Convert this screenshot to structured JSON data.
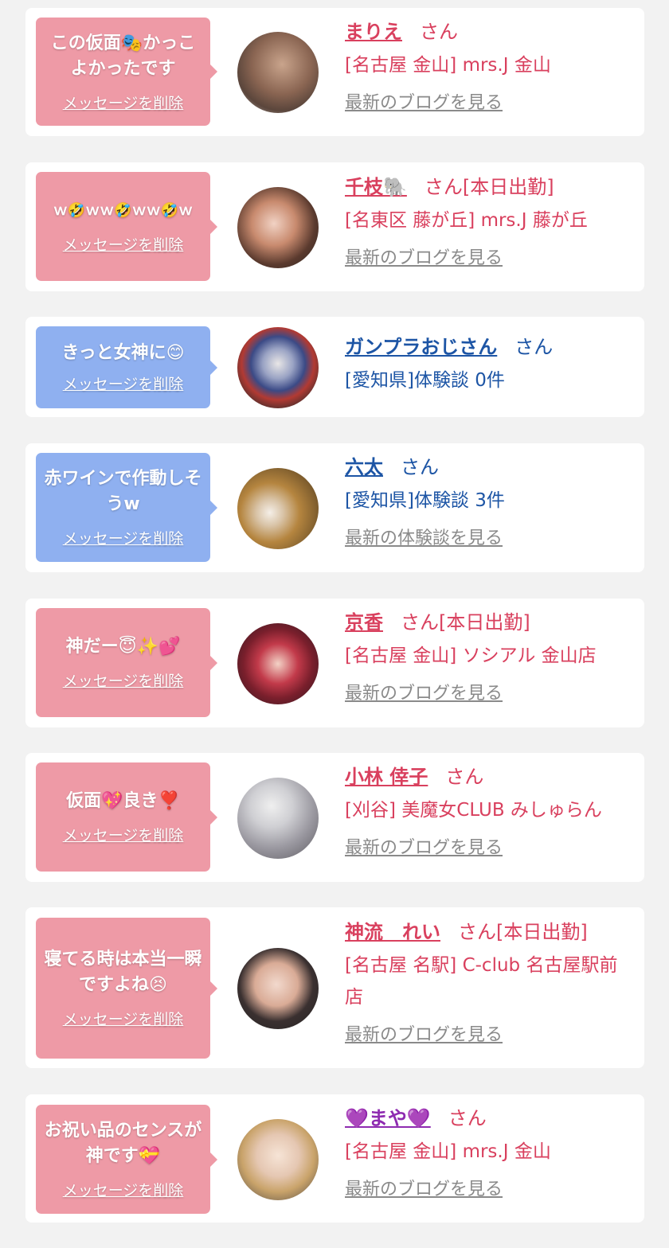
{
  "delete_label": "メッセージを削除",
  "cards": [
    {
      "message": "この仮面🎭かっこよかったです",
      "name": "まりえ",
      "suffix": "さん",
      "place": "[名古屋 金山] mrs.J 金山",
      "link": "最新のブログを見る",
      "theme": "pink"
    },
    {
      "message": "ｗ🤣ｗｗ🤣ｗｗ🤣ｗ",
      "name": "千枝🐘",
      "suffix": "さん[本日出勤]",
      "place": "[名東区 藤が丘] mrs.J 藤が丘",
      "link": "最新のブログを見る",
      "theme": "pink"
    },
    {
      "message": "きっと女神に😊",
      "name": "ガンプラおじさん",
      "suffix": "さん",
      "place": "[愛知県]体験談 0件",
      "link": "",
      "theme": "blue"
    },
    {
      "message": "赤ワインで作動しそうw",
      "name": "六太",
      "suffix": "さん",
      "place": "[愛知県]体験談 3件",
      "link": "最新の体験談を見る",
      "theme": "blue"
    },
    {
      "message": "神だー😇✨💕",
      "name": "京香",
      "suffix": "さん[本日出勤]",
      "place": "[名古屋 金山] ソシアル 金山店",
      "link": "最新のブログを見る",
      "theme": "pink"
    },
    {
      "message": "仮面💖良き❣️",
      "name": "小林 倖子",
      "suffix": "さん",
      "place": "[刈谷] 美魔女CLUB みしゅらん",
      "link": "最新のブログを見る",
      "theme": "pink"
    },
    {
      "message": "寝てる時は本当一瞬ですよね😣",
      "name": "神流　れい",
      "suffix": "さん[本日出勤]",
      "place": "[名古屋 名駅] C-club 名古屋駅前店",
      "link": "最新のブログを見る",
      "theme": "pink"
    },
    {
      "message": "お祝い品のセンスが神です💝",
      "name": "💜まや💜",
      "suffix": "さん",
      "place": "[名古屋 金山] mrs.J 金山",
      "link": "最新のブログを見る",
      "theme": "pink"
    }
  ],
  "colors": {
    "pink_bubble": "#ee9aa6",
    "blue_bubble": "#8fb0f0",
    "pink_text": "#d9405e",
    "blue_text": "#1d55a5",
    "purple_text": "#8e2bb0"
  },
  "avatars": [
    "avatar-photo-hair",
    "avatar-photo-woman",
    "avatar-photo-gundam",
    "avatar-photo-table",
    "avatar-photo-kimono",
    "avatar-photo-masked",
    "avatar-photo-woman",
    "avatar-photo-blonde"
  ]
}
